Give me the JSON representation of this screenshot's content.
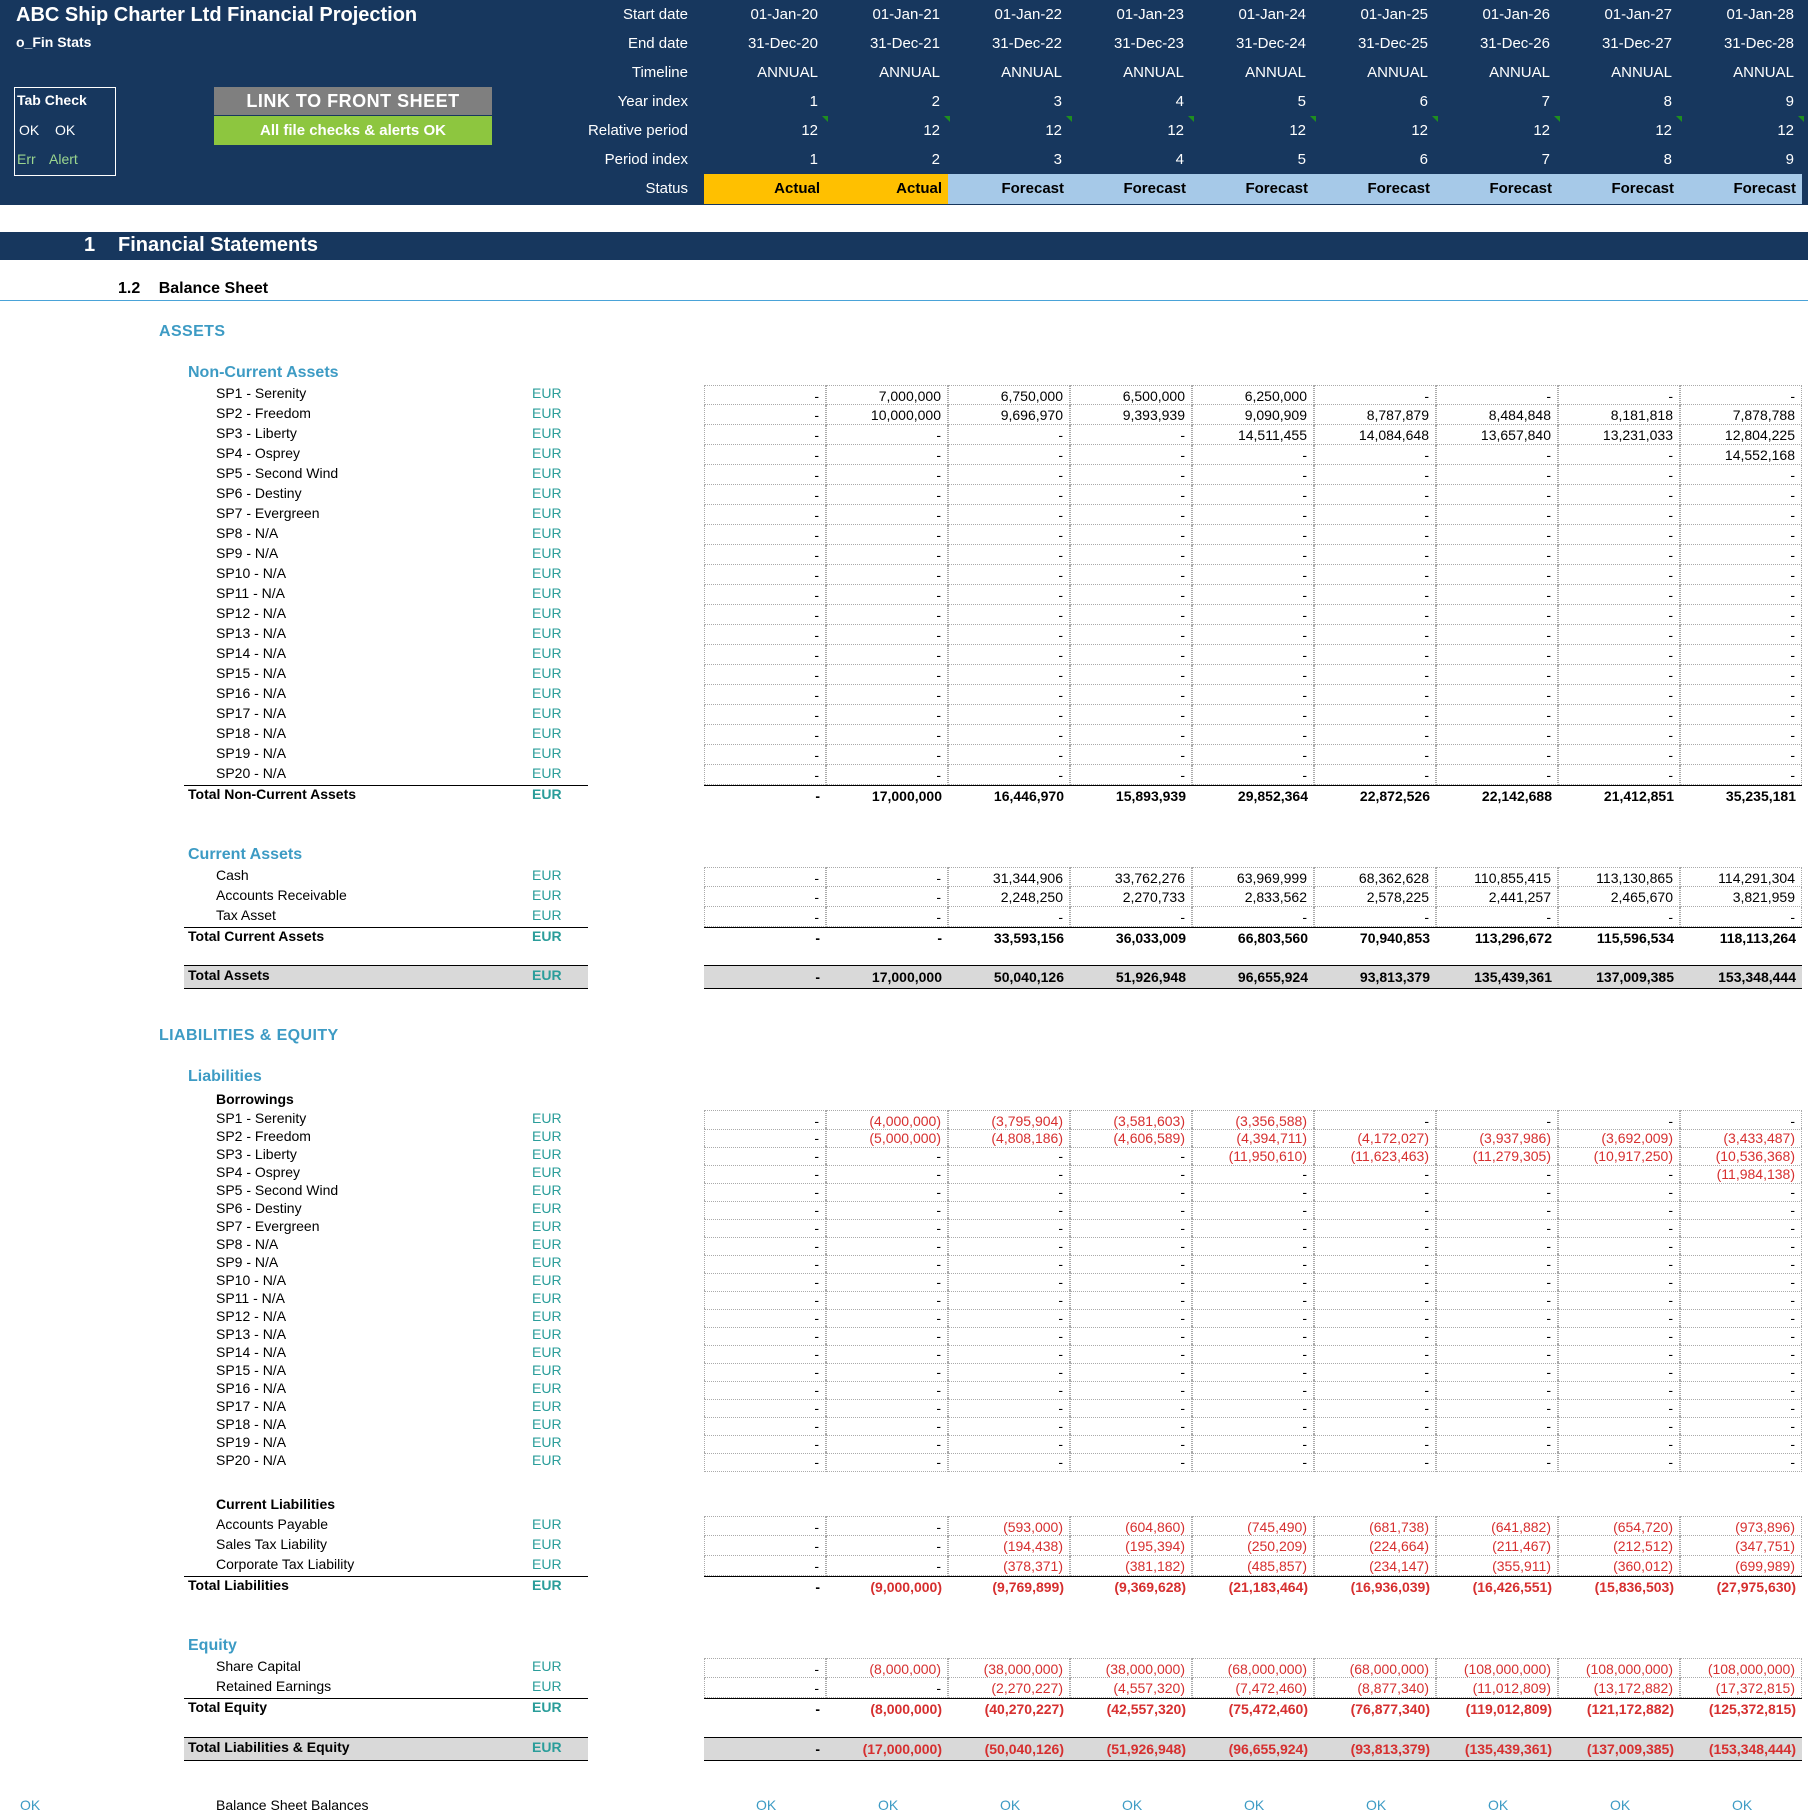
{
  "header": {
    "title": "ABC Ship Charter Ltd Financial Projection",
    "sheet": "o_Fin Stats",
    "tab_check": {
      "title": "Tab Check",
      "ok1": "OK",
      "ok2": "OK",
      "err": "Err",
      "alert": "Alert"
    },
    "link_button": "LINK TO FRONT SHEET",
    "status_msg": "All file checks & alerts OK",
    "row_labels": [
      "Start date",
      "End date",
      "Timeline",
      "Year index",
      "Relative period",
      "Period index",
      "Status"
    ],
    "start_dates": [
      "01-Jan-20",
      "01-Jan-21",
      "01-Jan-22",
      "01-Jan-23",
      "01-Jan-24",
      "01-Jan-25",
      "01-Jan-26",
      "01-Jan-27",
      "01-Jan-28"
    ],
    "end_dates": [
      "31-Dec-20",
      "31-Dec-21",
      "31-Dec-22",
      "31-Dec-23",
      "31-Dec-24",
      "31-Dec-25",
      "31-Dec-26",
      "31-Dec-27",
      "31-Dec-28"
    ],
    "timeline": [
      "ANNUAL",
      "ANNUAL",
      "ANNUAL",
      "ANNUAL",
      "ANNUAL",
      "ANNUAL",
      "ANNUAL",
      "ANNUAL",
      "ANNUAL"
    ],
    "year_index": [
      "1",
      "2",
      "3",
      "4",
      "5",
      "6",
      "7",
      "8",
      "9"
    ],
    "relative_period": [
      "12",
      "12",
      "12",
      "12",
      "12",
      "12",
      "12",
      "12",
      "12"
    ],
    "period_index": [
      "1",
      "2",
      "3",
      "4",
      "5",
      "6",
      "7",
      "8",
      "9"
    ],
    "status": [
      "Actual",
      "Actual",
      "Forecast",
      "Forecast",
      "Forecast",
      "Forecast",
      "Forecast",
      "Forecast",
      "Forecast"
    ],
    "colors": {
      "band": "#17375e",
      "actual": "#ffc000",
      "forecast": "#a6c9e8",
      "ok_green": "#8dc63f"
    }
  },
  "section": {
    "num": "1",
    "title": "Financial Statements"
  },
  "subsection": {
    "num": "1.2",
    "title": "Balance Sheet"
  },
  "assets": {
    "heading": "ASSETS",
    "non_current": {
      "heading": "Non-Current Assets",
      "rows": [
        {
          "label": "SP1 - Serenity",
          "unit": "EUR",
          "values": [
            "-",
            "7,000,000",
            "6,750,000",
            "6,500,000",
            "6,250,000",
            "-",
            "-",
            "-",
            "-"
          ]
        },
        {
          "label": "SP2 - Freedom",
          "unit": "EUR",
          "values": [
            "-",
            "10,000,000",
            "9,696,970",
            "9,393,939",
            "9,090,909",
            "8,787,879",
            "8,484,848",
            "8,181,818",
            "7,878,788"
          ]
        },
        {
          "label": "SP3 - Liberty",
          "unit": "EUR",
          "values": [
            "-",
            "-",
            "-",
            "-",
            "14,511,455",
            "14,084,648",
            "13,657,840",
            "13,231,033",
            "12,804,225"
          ]
        },
        {
          "label": "SP4 - Osprey",
          "unit": "EUR",
          "values": [
            "-",
            "-",
            "-",
            "-",
            "-",
            "-",
            "-",
            "-",
            "14,552,168"
          ]
        },
        {
          "label": "SP5 - Second Wind",
          "unit": "EUR",
          "values": [
            "-",
            "-",
            "-",
            "-",
            "-",
            "-",
            "-",
            "-",
            "-"
          ]
        },
        {
          "label": "SP6 - Destiny",
          "unit": "EUR",
          "values": [
            "-",
            "-",
            "-",
            "-",
            "-",
            "-",
            "-",
            "-",
            "-"
          ]
        },
        {
          "label": "SP7 - Evergreen",
          "unit": "EUR",
          "values": [
            "-",
            "-",
            "-",
            "-",
            "-",
            "-",
            "-",
            "-",
            "-"
          ]
        },
        {
          "label": "SP8 - N/A",
          "unit": "EUR",
          "values": [
            "-",
            "-",
            "-",
            "-",
            "-",
            "-",
            "-",
            "-",
            "-"
          ]
        },
        {
          "label": "SP9 - N/A",
          "unit": "EUR",
          "values": [
            "-",
            "-",
            "-",
            "-",
            "-",
            "-",
            "-",
            "-",
            "-"
          ]
        },
        {
          "label": "SP10 - N/A",
          "unit": "EUR",
          "values": [
            "-",
            "-",
            "-",
            "-",
            "-",
            "-",
            "-",
            "-",
            "-"
          ]
        },
        {
          "label": "SP11 - N/A",
          "unit": "EUR",
          "values": [
            "-",
            "-",
            "-",
            "-",
            "-",
            "-",
            "-",
            "-",
            "-"
          ]
        },
        {
          "label": "SP12 - N/A",
          "unit": "EUR",
          "values": [
            "-",
            "-",
            "-",
            "-",
            "-",
            "-",
            "-",
            "-",
            "-"
          ]
        },
        {
          "label": "SP13 - N/A",
          "unit": "EUR",
          "values": [
            "-",
            "-",
            "-",
            "-",
            "-",
            "-",
            "-",
            "-",
            "-"
          ]
        },
        {
          "label": "SP14 - N/A",
          "unit": "EUR",
          "values": [
            "-",
            "-",
            "-",
            "-",
            "-",
            "-",
            "-",
            "-",
            "-"
          ]
        },
        {
          "label": "SP15 - N/A",
          "unit": "EUR",
          "values": [
            "-",
            "-",
            "-",
            "-",
            "-",
            "-",
            "-",
            "-",
            "-"
          ]
        },
        {
          "label": "SP16 - N/A",
          "unit": "EUR",
          "values": [
            "-",
            "-",
            "-",
            "-",
            "-",
            "-",
            "-",
            "-",
            "-"
          ]
        },
        {
          "label": "SP17 - N/A",
          "unit": "EUR",
          "values": [
            "-",
            "-",
            "-",
            "-",
            "-",
            "-",
            "-",
            "-",
            "-"
          ]
        },
        {
          "label": "SP18 - N/A",
          "unit": "EUR",
          "values": [
            "-",
            "-",
            "-",
            "-",
            "-",
            "-",
            "-",
            "-",
            "-"
          ]
        },
        {
          "label": "SP19 - N/A",
          "unit": "EUR",
          "values": [
            "-",
            "-",
            "-",
            "-",
            "-",
            "-",
            "-",
            "-",
            "-"
          ]
        },
        {
          "label": "SP20 - N/A",
          "unit": "EUR",
          "values": [
            "-",
            "-",
            "-",
            "-",
            "-",
            "-",
            "-",
            "-",
            "-"
          ]
        }
      ],
      "total": {
        "label": "Total Non-Current Assets",
        "unit": "EUR",
        "values": [
          "-",
          "17,000,000",
          "16,446,970",
          "15,893,939",
          "29,852,364",
          "22,872,526",
          "22,142,688",
          "21,412,851",
          "35,235,181"
        ]
      }
    },
    "current": {
      "heading": "Current Assets",
      "rows": [
        {
          "label": "Cash",
          "unit": "EUR",
          "values": [
            "-",
            "-",
            "31,344,906",
            "33,762,276",
            "63,969,999",
            "68,362,628",
            "110,855,415",
            "113,130,865",
            "114,291,304"
          ]
        },
        {
          "label": "Accounts Receivable",
          "unit": "EUR",
          "values": [
            "-",
            "-",
            "2,248,250",
            "2,270,733",
            "2,833,562",
            "2,578,225",
            "2,441,257",
            "2,465,670",
            "3,821,959"
          ]
        },
        {
          "label": "Tax Asset",
          "unit": "EUR",
          "values": [
            "-",
            "-",
            "-",
            "-",
            "-",
            "-",
            "-",
            "-",
            "-"
          ]
        }
      ],
      "total": {
        "label": "Total Current Assets",
        "unit": "EUR",
        "values": [
          "-",
          "-",
          "33,593,156",
          "36,033,009",
          "66,803,560",
          "70,940,853",
          "113,296,672",
          "115,596,534",
          "118,113,264"
        ]
      }
    },
    "total": {
      "label": "Total Assets",
      "unit": "EUR",
      "values": [
        "-",
        "17,000,000",
        "50,040,126",
        "51,926,948",
        "96,655,924",
        "93,813,379",
        "135,439,361",
        "137,009,385",
        "153,348,444"
      ]
    }
  },
  "liabilities_equity": {
    "heading": "LIABILITIES & EQUITY",
    "liabilities": {
      "heading": "Liabilities",
      "borrowings": {
        "heading": "Borrowings",
        "rows": [
          {
            "label": "SP1 - Serenity",
            "unit": "EUR",
            "values": [
              "-",
              "(4,000,000)",
              "(3,795,904)",
              "(3,581,603)",
              "(3,356,588)",
              "-",
              "-",
              "-",
              "-"
            ]
          },
          {
            "label": "SP2 - Freedom",
            "unit": "EUR",
            "values": [
              "-",
              "(5,000,000)",
              "(4,808,186)",
              "(4,606,589)",
              "(4,394,711)",
              "(4,172,027)",
              "(3,937,986)",
              "(3,692,009)",
              "(3,433,487)"
            ]
          },
          {
            "label": "SP3 - Liberty",
            "unit": "EUR",
            "values": [
              "-",
              "-",
              "-",
              "-",
              "(11,950,610)",
              "(11,623,463)",
              "(11,279,305)",
              "(10,917,250)",
              "(10,536,368)"
            ]
          },
          {
            "label": "SP4 - Osprey",
            "unit": "EUR",
            "values": [
              "-",
              "-",
              "-",
              "-",
              "-",
              "-",
              "-",
              "-",
              "(11,984,138)"
            ]
          },
          {
            "label": "SP5 - Second Wind",
            "unit": "EUR",
            "values": [
              "-",
              "-",
              "-",
              "-",
              "-",
              "-",
              "-",
              "-",
              "-"
            ]
          },
          {
            "label": "SP6 - Destiny",
            "unit": "EUR",
            "values": [
              "-",
              "-",
              "-",
              "-",
              "-",
              "-",
              "-",
              "-",
              "-"
            ]
          },
          {
            "label": "SP7 - Evergreen",
            "unit": "EUR",
            "values": [
              "-",
              "-",
              "-",
              "-",
              "-",
              "-",
              "-",
              "-",
              "-"
            ]
          },
          {
            "label": "SP8 - N/A",
            "unit": "EUR",
            "values": [
              "-",
              "-",
              "-",
              "-",
              "-",
              "-",
              "-",
              "-",
              "-"
            ]
          },
          {
            "label": "SP9 - N/A",
            "unit": "EUR",
            "values": [
              "-",
              "-",
              "-",
              "-",
              "-",
              "-",
              "-",
              "-",
              "-"
            ]
          },
          {
            "label": "SP10 - N/A",
            "unit": "EUR",
            "values": [
              "-",
              "-",
              "-",
              "-",
              "-",
              "-",
              "-",
              "-",
              "-"
            ]
          },
          {
            "label": "SP11 - N/A",
            "unit": "EUR",
            "values": [
              "-",
              "-",
              "-",
              "-",
              "-",
              "-",
              "-",
              "-",
              "-"
            ]
          },
          {
            "label": "SP12 - N/A",
            "unit": "EUR",
            "values": [
              "-",
              "-",
              "-",
              "-",
              "-",
              "-",
              "-",
              "-",
              "-"
            ]
          },
          {
            "label": "SP13 - N/A",
            "unit": "EUR",
            "values": [
              "-",
              "-",
              "-",
              "-",
              "-",
              "-",
              "-",
              "-",
              "-"
            ]
          },
          {
            "label": "SP14 - N/A",
            "unit": "EUR",
            "values": [
              "-",
              "-",
              "-",
              "-",
              "-",
              "-",
              "-",
              "-",
              "-"
            ]
          },
          {
            "label": "SP15 - N/A",
            "unit": "EUR",
            "values": [
              "-",
              "-",
              "-",
              "-",
              "-",
              "-",
              "-",
              "-",
              "-"
            ]
          },
          {
            "label": "SP16 - N/A",
            "unit": "EUR",
            "values": [
              "-",
              "-",
              "-",
              "-",
              "-",
              "-",
              "-",
              "-",
              "-"
            ]
          },
          {
            "label": "SP17 - N/A",
            "unit": "EUR",
            "values": [
              "-",
              "-",
              "-",
              "-",
              "-",
              "-",
              "-",
              "-",
              "-"
            ]
          },
          {
            "label": "SP18 - N/A",
            "unit": "EUR",
            "values": [
              "-",
              "-",
              "-",
              "-",
              "-",
              "-",
              "-",
              "-",
              "-"
            ]
          },
          {
            "label": "SP19 - N/A",
            "unit": "EUR",
            "values": [
              "-",
              "-",
              "-",
              "-",
              "-",
              "-",
              "-",
              "-",
              "-"
            ]
          },
          {
            "label": "SP20 - N/A",
            "unit": "EUR",
            "values": [
              "-",
              "-",
              "-",
              "-",
              "-",
              "-",
              "-",
              "-",
              "-"
            ]
          }
        ]
      },
      "current": {
        "heading": "Current Liabilities",
        "rows": [
          {
            "label": "Accounts Payable",
            "unit": "EUR",
            "values": [
              "-",
              "-",
              "(593,000)",
              "(604,860)",
              "(745,490)",
              "(681,738)",
              "(641,882)",
              "(654,720)",
              "(973,896)"
            ]
          },
          {
            "label": "Sales Tax Liability",
            "unit": "EUR",
            "values": [
              "-",
              "-",
              "(194,438)",
              "(195,394)",
              "(250,209)",
              "(224,664)",
              "(211,467)",
              "(212,512)",
              "(347,751)"
            ]
          },
          {
            "label": "Corporate Tax Liability",
            "unit": "EUR",
            "values": [
              "-",
              "-",
              "(378,371)",
              "(381,182)",
              "(485,857)",
              "(234,147)",
              "(355,911)",
              "(360,012)",
              "(699,989)"
            ]
          }
        ]
      },
      "total": {
        "label": "Total Liabilities",
        "unit": "EUR",
        "values": [
          "-",
          "(9,000,000)",
          "(9,769,899)",
          "(9,369,628)",
          "(21,183,464)",
          "(16,936,039)",
          "(16,426,551)",
          "(15,836,503)",
          "(27,975,630)"
        ]
      }
    },
    "equity": {
      "heading": "Equity",
      "rows": [
        {
          "label": "Share Capital",
          "unit": "EUR",
          "values": [
            "-",
            "(8,000,000)",
            "(38,000,000)",
            "(38,000,000)",
            "(68,000,000)",
            "(68,000,000)",
            "(108,000,000)",
            "(108,000,000)",
            "(108,000,000)"
          ]
        },
        {
          "label": "Retained Earnings",
          "unit": "EUR",
          "values": [
            "-",
            "-",
            "(2,270,227)",
            "(4,557,320)",
            "(7,472,460)",
            "(8,877,340)",
            "(11,012,809)",
            "(13,172,882)",
            "(17,372,815)"
          ]
        }
      ],
      "total": {
        "label": "Total Equity",
        "unit": "EUR",
        "values": [
          "-",
          "(8,000,000)",
          "(40,270,227)",
          "(42,557,320)",
          "(75,472,460)",
          "(76,877,340)",
          "(119,012,809)",
          "(121,172,882)",
          "(125,372,815)"
        ]
      }
    },
    "total": {
      "label": "Total Liabilities & Equity",
      "unit": "EUR",
      "values": [
        "-",
        "(17,000,000)",
        "(50,040,126)",
        "(51,926,948)",
        "(96,655,924)",
        "(93,813,379)",
        "(135,439,361)",
        "(137,009,385)",
        "(153,348,444)"
      ]
    }
  },
  "balance_check": {
    "flag": "OK",
    "label": "Balance Sheet Balances",
    "values": [
      "OK",
      "OK",
      "OK",
      "OK",
      "OK",
      "OK",
      "OK",
      "OK",
      "OK"
    ]
  }
}
